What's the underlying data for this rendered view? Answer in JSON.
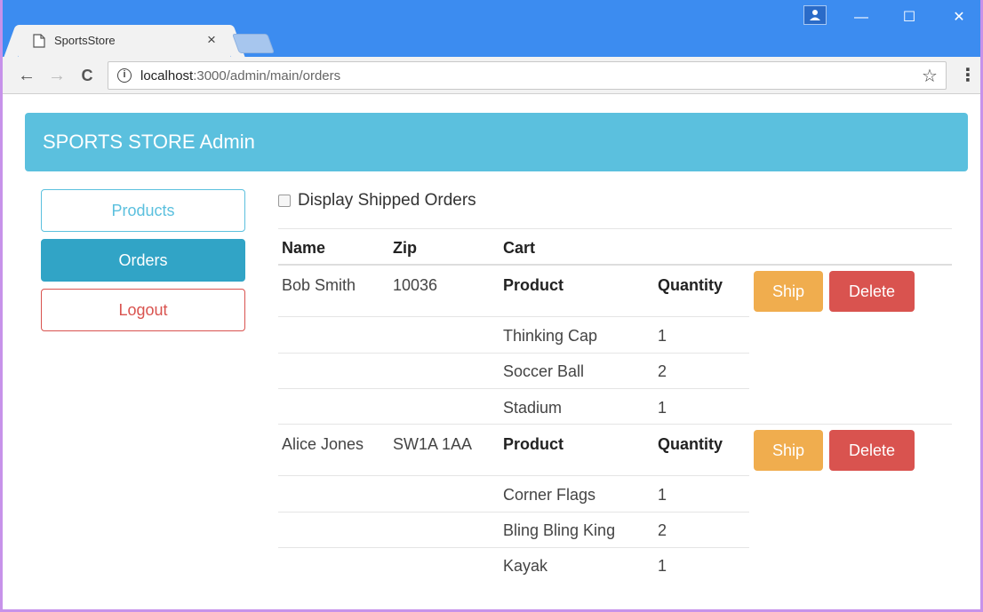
{
  "browser": {
    "tab_title": "SportsStore",
    "tab_close": "×",
    "url_host": "localhost",
    "url_rest": ":3000/admin/main/orders",
    "info_glyph": "i",
    "back_glyph": "←",
    "forward_glyph": "→",
    "reload_glyph": "C",
    "star_glyph": "☆",
    "menu_glyph": "⋮",
    "minimize_glyph": "—",
    "maximize_glyph": "☐",
    "close_glyph": "✕",
    "profile_glyph": "▴"
  },
  "app": {
    "brand": "SPORTS STORE Admin",
    "nav": {
      "products": "Products",
      "orders": "Orders",
      "logout": "Logout"
    },
    "filter_label": "Display Shipped Orders",
    "table_headers": {
      "name": "Name",
      "zip": "Zip",
      "cart": "Cart"
    },
    "cart_headers": {
      "product": "Product",
      "quantity": "Quantity"
    },
    "actions": {
      "ship": "Ship",
      "delete": "Delete"
    },
    "orders": [
      {
        "name": "Bob Smith",
        "zip": "10036",
        "lines": [
          {
            "product": "Thinking Cap",
            "quantity": "1"
          },
          {
            "product": "Soccer Ball",
            "quantity": "2"
          },
          {
            "product": "Stadium",
            "quantity": "1"
          }
        ]
      },
      {
        "name": "Alice Jones",
        "zip": "SW1A 1AA",
        "lines": [
          {
            "product": "Corner Flags",
            "quantity": "1"
          },
          {
            "product": "Bling Bling King",
            "quantity": "2"
          },
          {
            "product": "Kayak",
            "quantity": "1"
          }
        ]
      }
    ]
  },
  "colors": {
    "titlebar": "#3c8cf0",
    "navbar": "#5bc0de",
    "info": "#5bc0de",
    "primary_active": "#31a4c6",
    "danger": "#d9534f",
    "warning": "#f0ad4e"
  }
}
